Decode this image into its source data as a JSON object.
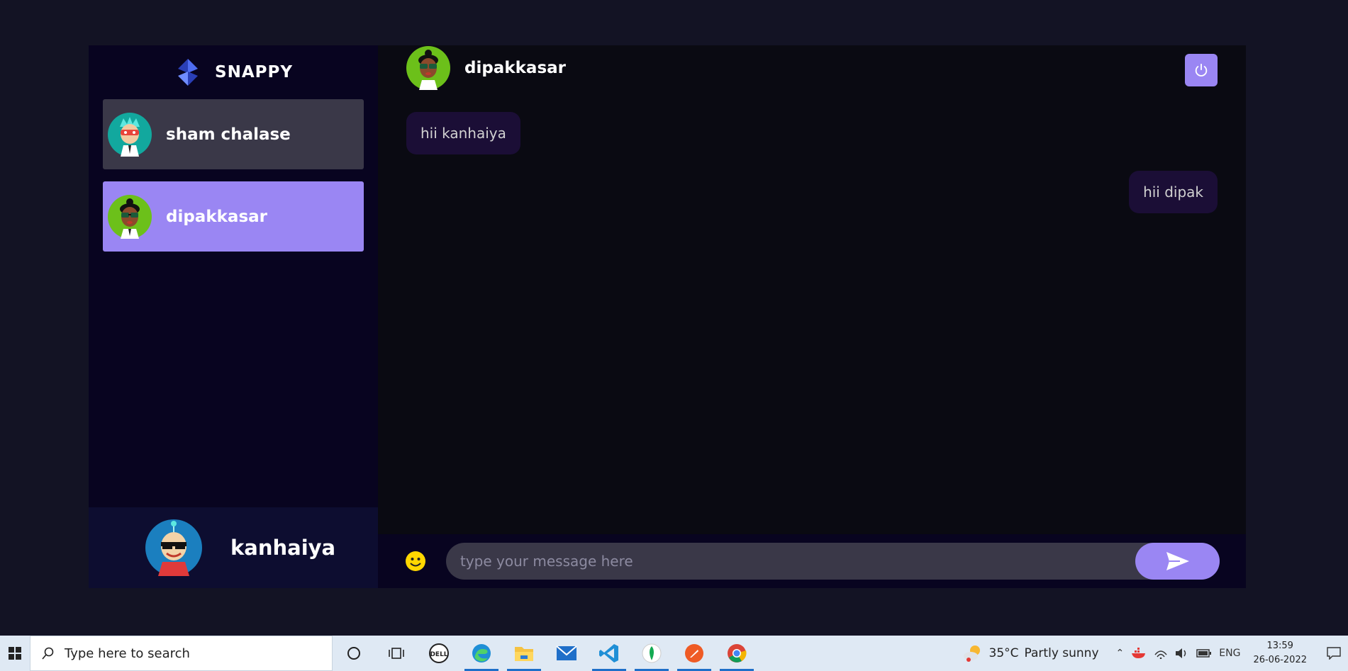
{
  "app": {
    "brand": "SNAPPY",
    "contacts": [
      {
        "name": "sham chalase",
        "selected": false
      },
      {
        "name": "dipakkasar",
        "selected": true
      }
    ],
    "current_user": {
      "name": "kanhaiya"
    },
    "colors": {
      "accent": "#9a86f3",
      "sidebar_bg": "#080420",
      "bubble_bg": "#1b0e36"
    }
  },
  "chat": {
    "contact_name": "dipakkasar",
    "messages": [
      {
        "text": "hii kanhaiya",
        "direction": "received"
      },
      {
        "text": "hii dipak",
        "direction": "sent"
      }
    ],
    "input": {
      "placeholder": "type your message here",
      "value": ""
    },
    "icons": {
      "logout": "power-icon",
      "emoji": "smiley-icon",
      "send": "send-icon"
    }
  },
  "taskbar": {
    "search_placeholder": "Type here to search",
    "weather": {
      "temp": "35°C",
      "condition": "Partly sunny"
    },
    "language": "ENG",
    "time": "13:59",
    "date": "26-06-2022",
    "apps": [
      "cortana-icon",
      "task-view-icon",
      "dell-icon",
      "edge-icon",
      "file-explorer-icon",
      "mail-icon",
      "vscode-icon",
      "mongodb-icon",
      "postman-icon",
      "chrome-icon"
    ]
  }
}
